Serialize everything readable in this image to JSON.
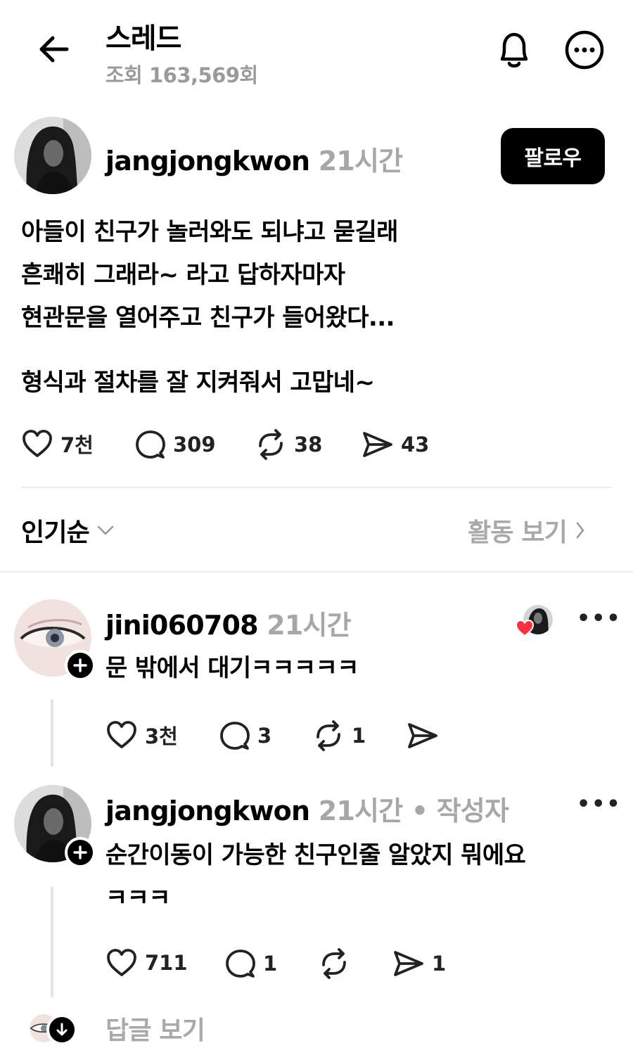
{
  "header": {
    "title": "스레드",
    "views": "조회 163,569회"
  },
  "post": {
    "username": "jangjongkwon",
    "time": "21시간",
    "follow_label": "팔로우",
    "lines": [
      "아들이 친구가 놀러와도 되냐고 묻길래",
      "흔쾌히 그래라~ 라고 답하자마자",
      "현관문을 열어주고 친구가 들어왔다...",
      "형식과 절차를 잘 지켜줘서 고맙네~"
    ],
    "stats": {
      "likes": "7천",
      "comments": "309",
      "reposts": "38",
      "shares": "43"
    }
  },
  "sort": {
    "label": "인기순",
    "activity_label": "활동 보기"
  },
  "comments": [
    {
      "username": "jini060708",
      "time": "21시간",
      "text": "문 밖에서 대기ㅋㅋㅋㅋㅋ",
      "stats": {
        "likes": "3천",
        "comments": "3",
        "reposts": "1",
        "shares": ""
      }
    },
    {
      "username": "jangjongkwon",
      "time": "21시간",
      "author_tag": " • 작성자",
      "text_lines": [
        "순간이동이 가능한 친구인줄 알았지 뭐에요",
        "ㅋㅋㅋ"
      ],
      "stats": {
        "likes": "711",
        "comments": "1",
        "reposts": "",
        "shares": "1"
      }
    }
  ],
  "see_replies_label": "답글 보기",
  "icons": {
    "back": "arrow-left-icon",
    "bell": "bell-icon",
    "more": "more-circle-icon",
    "heart": "heart-icon",
    "comment": "comment-bubble-icon",
    "repost": "repost-icon",
    "share": "send-icon"
  }
}
